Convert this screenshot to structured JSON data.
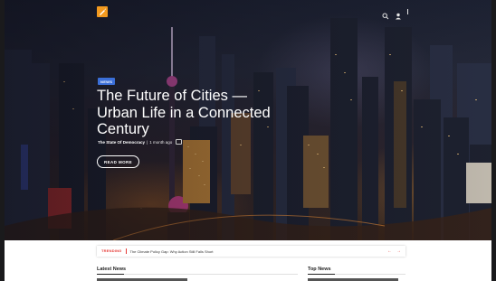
{
  "brand": {
    "accent": "#f39a1f"
  },
  "header": {
    "icons": [
      "search-icon",
      "user-icon"
    ]
  },
  "hero": {
    "category": "NEWS",
    "headline": "The Future of Cities — Urban Life in a Connected Century",
    "author": "The State Of Democracy",
    "separator": "|",
    "time": "1 month ago",
    "cta": "READ MORE"
  },
  "trending": {
    "label": "TRENDING",
    "text": "The Climate Policy Gap: Why Action Still Falls Short"
  },
  "sections": {
    "latest": "Latest News",
    "top": "Top News"
  },
  "colors": {
    "badge": "#3b6fd8",
    "trending": "#e53935"
  }
}
